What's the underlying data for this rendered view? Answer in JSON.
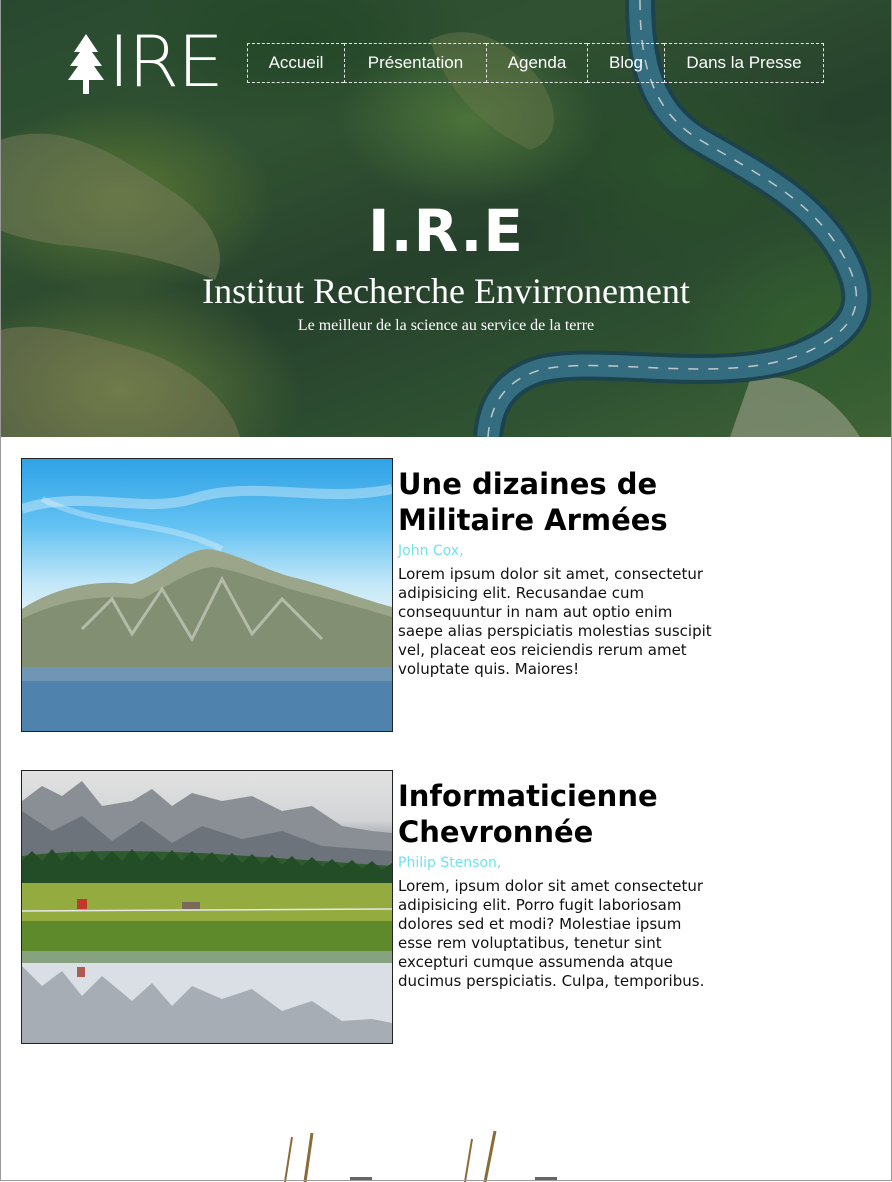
{
  "header": {
    "logo_text": "IRE",
    "nav": [
      "Accueil",
      "Présentation",
      "Agenda",
      "Blog",
      "Dans la Presse"
    ],
    "title": "I.R.E",
    "subtitle": "Institut Recherche Envirronement",
    "tagline": "Le meilleur de la science au service de la terre"
  },
  "articles": [
    {
      "title": "Une dizaines de Militaire Armées",
      "author": "John Cox,",
      "body": "Lorem ipsum dolor sit amet, consectetur adipisicing elit. Recusandae cum consequuntur in nam aut optio enim saepe alias perspiciatis molestias suscipit vel, placeat eos reiciendis rerum amet voluptate quis. Maiores!"
    },
    {
      "title": "Informaticienne Chevronnée",
      "author": "Philip Stenson,",
      "body": "Lorem, ipsum dolor sit amet consectetur adipisicing elit. Porro fugit laboriosam dolores sed et modi? Molestiae ipsum esse rem voluptatibus, tenetur sint excepturi cumque assumenda atque ducimus perspiciatis. Culpa, temporibus."
    }
  ],
  "colors": {
    "author": "#6fe3f0",
    "nav_border": "#e6e6e6",
    "hero_forest": "#2f5436",
    "road": "#2c5f78"
  },
  "icons": {
    "logo": "pine-tree-icon"
  }
}
